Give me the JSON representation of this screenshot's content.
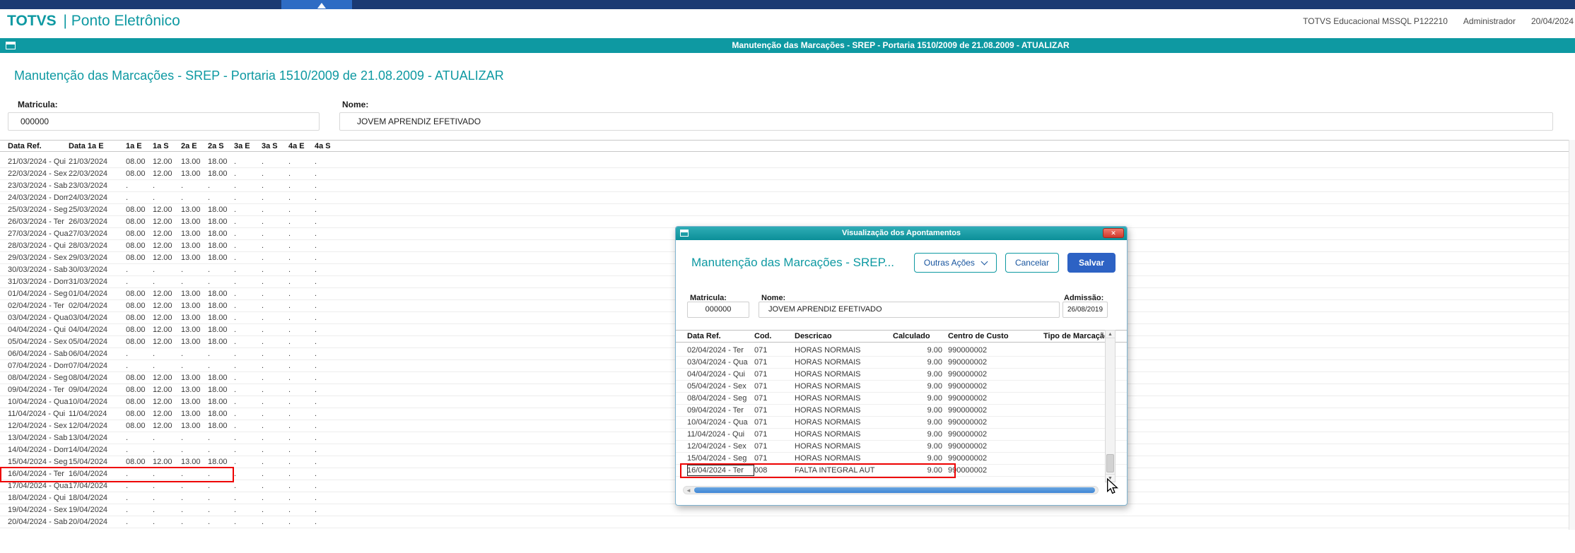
{
  "colors": {
    "teal": "#0e99a2",
    "navy": "#1b3a73",
    "tab_blue": "#2e6cc4",
    "primary_blue": "#2d62c4",
    "highlight_red": "#ee0000",
    "scroll_thumb_blue": "#3f86d6"
  },
  "icons": {
    "window": "window-icon",
    "close": "✕",
    "chevron_down": "chevron-down",
    "scroll_up": "▲",
    "scroll_down": "▼",
    "scroll_left": "◄"
  },
  "header": {
    "brand_bold": "TOTVS",
    "brand_rest": "| Ponto Eletrônico",
    "environment": "TOTVS Educacional MSSQL P122210",
    "user": "Administrador",
    "date": "20/04/2024"
  },
  "banner": {
    "text": "Manutenção das Marcações - SREP - Portaria 1510/2009 de 21.08.2009 - ATUALIZAR"
  },
  "page": {
    "title": "Manutenção das Marcações - SREP - Portaria 1510/2009 de 21.08.2009 - ATUALIZAR",
    "matricula_label": "Matricula:",
    "matricula_value": "000000",
    "nome_label": "Nome:",
    "nome_value": "JOVEM APRENDIZ EFETIVADO"
  },
  "grid": {
    "columns": [
      "Data Ref.",
      "Data 1a E",
      "1a E",
      "1a S",
      "2a E",
      "2a S",
      "3a E",
      "3a S",
      "4a E",
      "4a S"
    ],
    "highlighted_row_index": 26,
    "rows": [
      [
        "21/03/2024 - Qui",
        "21/03/2024",
        "08.00",
        "12.00",
        "13.00",
        "18.00",
        ".",
        ".",
        ".",
        "."
      ],
      [
        "22/03/2024 - Sex",
        "22/03/2024",
        "08.00",
        "12.00",
        "13.00",
        "18.00",
        ".",
        ".",
        ".",
        "."
      ],
      [
        "23/03/2024 - Sab",
        "23/03/2024",
        ".",
        ".",
        ".",
        ".",
        ".",
        ".",
        ".",
        "."
      ],
      [
        "24/03/2024 - Dom",
        "24/03/2024",
        ".",
        ".",
        ".",
        ".",
        ".",
        ".",
        ".",
        "."
      ],
      [
        "25/03/2024 - Seg",
        "25/03/2024",
        "08.00",
        "12.00",
        "13.00",
        "18.00",
        ".",
        ".",
        ".",
        "."
      ],
      [
        "26/03/2024 - Ter",
        "26/03/2024",
        "08.00",
        "12.00",
        "13.00",
        "18.00",
        ".",
        ".",
        ".",
        "."
      ],
      [
        "27/03/2024 - Qua",
        "27/03/2024",
        "08.00",
        "12.00",
        "13.00",
        "18.00",
        ".",
        ".",
        ".",
        "."
      ],
      [
        "28/03/2024 - Qui",
        "28/03/2024",
        "08.00",
        "12.00",
        "13.00",
        "18.00",
        ".",
        ".",
        ".",
        "."
      ],
      [
        "29/03/2024 - Sex",
        "29/03/2024",
        "08.00",
        "12.00",
        "13.00",
        "18.00",
        ".",
        ".",
        ".",
        "."
      ],
      [
        "30/03/2024 - Sab",
        "30/03/2024",
        ".",
        ".",
        ".",
        ".",
        ".",
        ".",
        ".",
        "."
      ],
      [
        "31/03/2024 - Dom",
        "31/03/2024",
        ".",
        ".",
        ".",
        ".",
        ".",
        ".",
        ".",
        "."
      ],
      [
        "01/04/2024 - Seg",
        "01/04/2024",
        "08.00",
        "12.00",
        "13.00",
        "18.00",
        ".",
        ".",
        ".",
        "."
      ],
      [
        "02/04/2024 - Ter",
        "02/04/2024",
        "08.00",
        "12.00",
        "13.00",
        "18.00",
        ".",
        ".",
        ".",
        "."
      ],
      [
        "03/04/2024 - Qua",
        "03/04/2024",
        "08.00",
        "12.00",
        "13.00",
        "18.00",
        ".",
        ".",
        ".",
        "."
      ],
      [
        "04/04/2024 - Qui",
        "04/04/2024",
        "08.00",
        "12.00",
        "13.00",
        "18.00",
        ".",
        ".",
        ".",
        "."
      ],
      [
        "05/04/2024 - Sex",
        "05/04/2024",
        "08.00",
        "12.00",
        "13.00",
        "18.00",
        ".",
        ".",
        ".",
        "."
      ],
      [
        "06/04/2024 - Sab",
        "06/04/2024",
        ".",
        ".",
        ".",
        ".",
        ".",
        ".",
        ".",
        "."
      ],
      [
        "07/04/2024 - Dom",
        "07/04/2024",
        ".",
        ".",
        ".",
        ".",
        ".",
        ".",
        ".",
        "."
      ],
      [
        "08/04/2024 - Seg",
        "08/04/2024",
        "08.00",
        "12.00",
        "13.00",
        "18.00",
        ".",
        ".",
        ".",
        "."
      ],
      [
        "09/04/2024 - Ter",
        "09/04/2024",
        "08.00",
        "12.00",
        "13.00",
        "18.00",
        ".",
        ".",
        ".",
        "."
      ],
      [
        "10/04/2024 - Qua",
        "10/04/2024",
        "08.00",
        "12.00",
        "13.00",
        "18.00",
        ".",
        ".",
        ".",
        "."
      ],
      [
        "11/04/2024 - Qui",
        "11/04/2024",
        "08.00",
        "12.00",
        "13.00",
        "18.00",
        ".",
        ".",
        ".",
        "."
      ],
      [
        "12/04/2024 - Sex",
        "12/04/2024",
        "08.00",
        "12.00",
        "13.00",
        "18.00",
        ".",
        ".",
        ".",
        "."
      ],
      [
        "13/04/2024 - Sab",
        "13/04/2024",
        ".",
        ".",
        ".",
        ".",
        ".",
        ".",
        ".",
        "."
      ],
      [
        "14/04/2024 - Dom",
        "14/04/2024",
        ".",
        ".",
        ".",
        ".",
        ".",
        ".",
        ".",
        "."
      ],
      [
        "15/04/2024 - Seg",
        "15/04/2024",
        "08.00",
        "12.00",
        "13.00",
        "18.00",
        ".",
        ".",
        ".",
        "."
      ],
      [
        "16/04/2024 - Ter",
        "16/04/2024",
        ".",
        ".",
        ".",
        ".",
        ".",
        ".",
        ".",
        "."
      ],
      [
        "17/04/2024 - Qua",
        "17/04/2024",
        ".",
        ".",
        ".",
        ".",
        ".",
        ".",
        ".",
        "."
      ],
      [
        "18/04/2024 - Qui",
        "18/04/2024",
        ".",
        ".",
        ".",
        ".",
        ".",
        ".",
        ".",
        "."
      ],
      [
        "19/04/2024 - Sex",
        "19/04/2024",
        ".",
        ".",
        ".",
        ".",
        ".",
        ".",
        ".",
        "."
      ],
      [
        "20/04/2024 - Sab",
        "20/04/2024",
        ".",
        ".",
        ".",
        ".",
        ".",
        ".",
        ".",
        "."
      ]
    ]
  },
  "modal": {
    "titlebar_title": "Visualização dos Apontamentos",
    "title": "Manutenção das Marcações - SREP...",
    "outras_acoes_label": "Outras Ações",
    "cancelar_label": "Cancelar",
    "salvar_label": "Salvar",
    "matricula_label": "Matricula:",
    "matricula_value": "000000",
    "nome_label": "Nome:",
    "nome_value": "JOVEM APRENDIZ EFETIVADO",
    "admissao_label": "Admissão:",
    "admissao_value": "26/08/2019",
    "table": {
      "columns": [
        "Data Ref.",
        "Cod.",
        "Descricao",
        "Calculado",
        "Centro de Custo",
        "Tipo de Marcação"
      ],
      "highlighted_row_index": 10,
      "rows": [
        [
          "02/04/2024 - Ter",
          "071",
          "HORAS NORMAIS",
          "9.00",
          "990000002",
          ""
        ],
        [
          "03/04/2024 - Qua",
          "071",
          "HORAS NORMAIS",
          "9.00",
          "990000002",
          ""
        ],
        [
          "04/04/2024 - Qui",
          "071",
          "HORAS NORMAIS",
          "9.00",
          "990000002",
          ""
        ],
        [
          "05/04/2024 - Sex",
          "071",
          "HORAS NORMAIS",
          "9.00",
          "990000002",
          ""
        ],
        [
          "08/04/2024 - Seg",
          "071",
          "HORAS NORMAIS",
          "9.00",
          "990000002",
          ""
        ],
        [
          "09/04/2024 - Ter",
          "071",
          "HORAS NORMAIS",
          "9.00",
          "990000002",
          ""
        ],
        [
          "10/04/2024 - Qua",
          "071",
          "HORAS NORMAIS",
          "9.00",
          "990000002",
          ""
        ],
        [
          "11/04/2024 - Qui",
          "071",
          "HORAS NORMAIS",
          "9.00",
          "990000002",
          ""
        ],
        [
          "12/04/2024 - Sex",
          "071",
          "HORAS NORMAIS",
          "9.00",
          "990000002",
          ""
        ],
        [
          "15/04/2024 - Seg",
          "071",
          "HORAS NORMAIS",
          "9.00",
          "990000002",
          ""
        ],
        [
          "16/04/2024 - Ter",
          "008",
          "FALTA INTEGRAL AUT",
          "9.00",
          "990000002",
          ""
        ]
      ]
    }
  }
}
